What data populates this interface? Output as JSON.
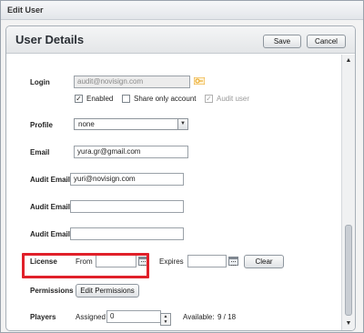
{
  "window": {
    "title": "Edit User"
  },
  "panel": {
    "title": "User Details",
    "save_label": "Save",
    "cancel_label": "Cancel"
  },
  "form": {
    "login_label": "Login",
    "login_value": "audit@novisign.com",
    "enabled_label": "Enabled",
    "enabled_checked": true,
    "share_only_label": "Share only account",
    "share_only_checked": false,
    "audit_user_label": "Audit user",
    "audit_user_checked": true,
    "profile_label": "Profile",
    "profile_value": "none",
    "email_label": "Email",
    "email_value": "yura.gr@gmail.com",
    "audit_email_1_label": "Audit Email",
    "audit_email_1_value": "yuri@novisign.com",
    "audit_email_2_label": "Audit Email",
    "audit_email_2_value": "",
    "audit_email_3_label": "Audit Email",
    "audit_email_3_value": "",
    "license_label": "License",
    "license_from_label": "From",
    "license_from_value": "",
    "license_expires_label": "Expires",
    "license_expires_value": "",
    "license_clear_label": "Clear",
    "permissions_label": "Permissions",
    "edit_permissions_label": "Edit Permissions",
    "players_label": "Players",
    "players_assigned_label": "Assigned",
    "players_assigned_value": "0",
    "players_available_label": "Available:",
    "players_available_value": "9 / 18"
  },
  "icons": {
    "key": "key-icon",
    "calendar": "calendar-icon",
    "scroll_up": "scroll-up-arrow-icon",
    "scroll_down": "scroll-down-arrow-icon",
    "dropdown": "chevron-down-icon"
  },
  "colors": {
    "highlight": "#e0202a",
    "key_icon": "#e8a21a"
  }
}
